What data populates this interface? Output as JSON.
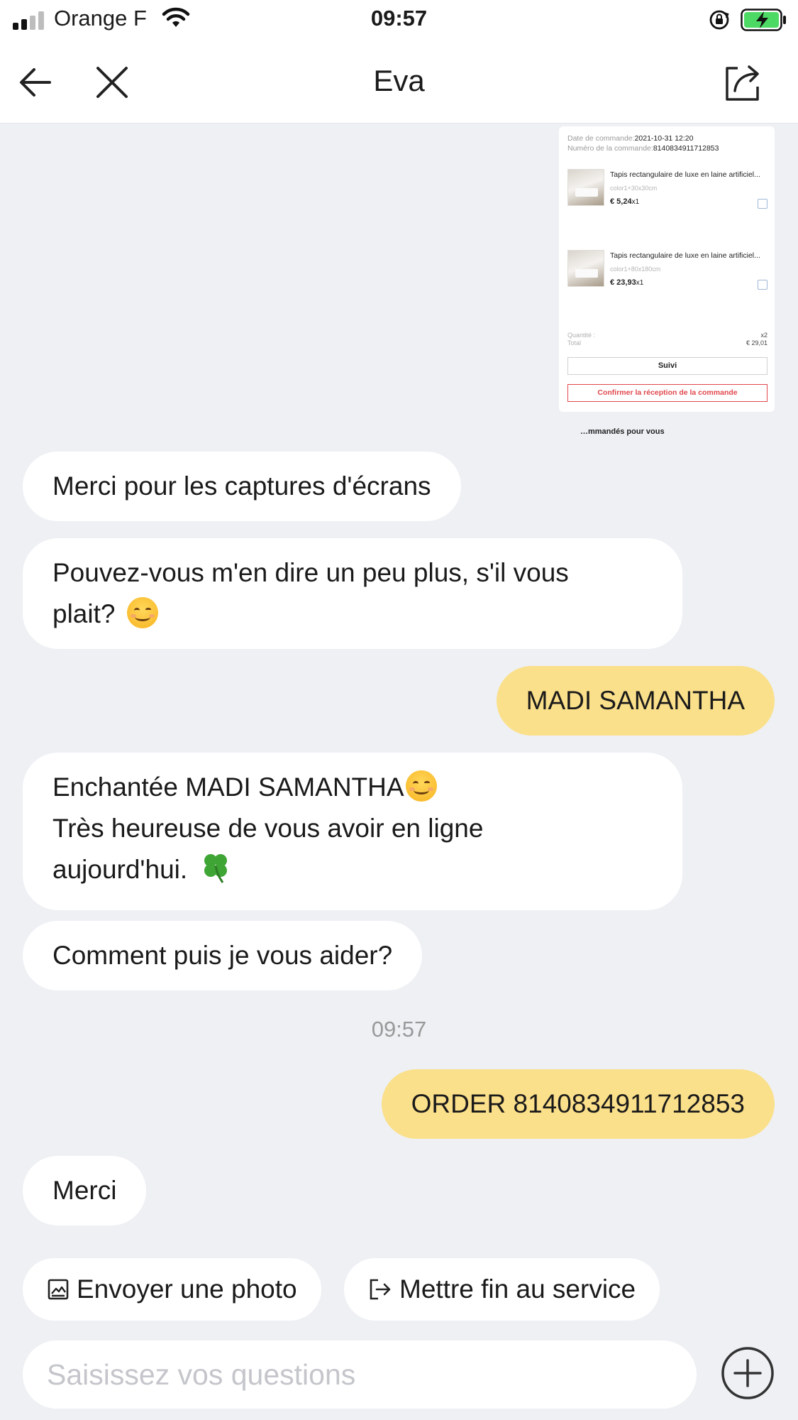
{
  "status_bar": {
    "carrier": "Orange F",
    "time": "09:57",
    "signal_bars_active": 2,
    "signal_bars_total": 4,
    "battery_color": "#4cd964"
  },
  "nav": {
    "title": "Eva",
    "back_icon": "arrow-left-icon",
    "close_icon": "close-icon",
    "share_icon": "share-icon"
  },
  "order_card": {
    "date_label": "Date de commande:",
    "date_value": "2021-10-31 12:20",
    "number_label": "Numéro de la commande:",
    "number_value": "8140834911712853",
    "items": [
      {
        "name": "Tapis rectangulaire de luxe en laine artificiel...",
        "variant": "color1+30x30cm",
        "price": "€ 5,24",
        "qty": "x1"
      },
      {
        "name": "Tapis rectangulaire de luxe en laine artificiel...",
        "variant": "color1+80x180cm",
        "price": "€ 23,93",
        "qty": "x1"
      }
    ],
    "quantity_label": "Quantité :",
    "quantity_value": "x2",
    "total_label": "Total",
    "total_value": "€ 29,01",
    "track_button": "Suivi",
    "confirm_button": "Confirmer la réception de la commande",
    "below_text": "…mmandés pour vous"
  },
  "messages": [
    {
      "side": "in",
      "text": "Merci pour les captures d'écrans"
    },
    {
      "side": "in",
      "line1": "Pouvez-vous m'en dire un peu plus, s'il vous",
      "line2": "plait?",
      "emoji": "smiling-face"
    },
    {
      "side": "out",
      "text": "MADI SAMANTHA"
    },
    {
      "side": "in",
      "line1": "Enchantée MADI SAMANTHA",
      "line2": "Très heureuse de vous avoir en ligne",
      "line3": "aujourd'hui.",
      "emoji1": "smiling-face",
      "emoji2": "four-leaf-clover"
    },
    {
      "side": "in",
      "text": "Comment puis je vous aider?"
    },
    {
      "side": "out",
      "text": "ORDER 8140834911712853"
    },
    {
      "side": "in",
      "text": "Merci"
    }
  ],
  "timestamp": "09:57",
  "quick_actions": {
    "send_photo": "Envoyer une photo",
    "end_service": "Mettre fin au service"
  },
  "input": {
    "placeholder": "Saisissez vos questions",
    "value": ""
  },
  "colors": {
    "incoming_bubble": "#ffffff",
    "outgoing_bubble": "#fbe08b",
    "background": "#eef0f4",
    "confirm_red": "#e0474c"
  }
}
